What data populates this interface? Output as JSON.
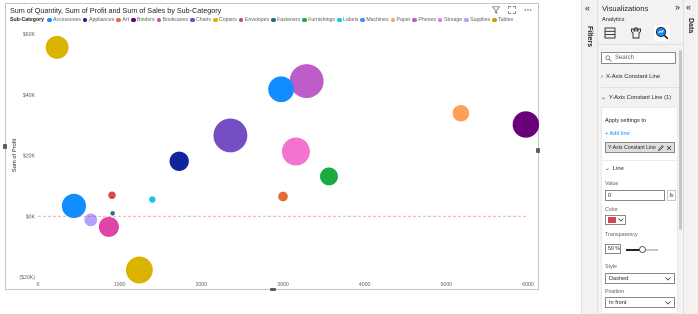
{
  "visual": {
    "title": "Sum of Quantity, Sum of Profit and Sum of Sales by Sub-Category",
    "header_icons": [
      "filter-icon",
      "focus-mode-icon",
      "more-options-icon"
    ]
  },
  "legend": {
    "title": "Sub-Category",
    "items": [
      {
        "label": "Accessories",
        "color": "#118dff"
      },
      {
        "label": "Appliances",
        "color": "#12239e"
      },
      {
        "label": "Art",
        "color": "#e66c37"
      },
      {
        "label": "Binders",
        "color": "#6b007b"
      },
      {
        "label": "Bookcases",
        "color": "#e044a7"
      },
      {
        "label": "Chairs",
        "color": "#744ec2"
      },
      {
        "label": "Copiers",
        "color": "#d9b300"
      },
      {
        "label": "Envelopes",
        "color": "#d64550"
      },
      {
        "label": "Fasteners",
        "color": "#197278"
      },
      {
        "label": "Furnishings",
        "color": "#1aab40"
      },
      {
        "label": "Labels",
        "color": "#15c6f4"
      },
      {
        "label": "Machines",
        "color": "#4092ff"
      },
      {
        "label": "Paper",
        "color": "#ffa058"
      },
      {
        "label": "Phones",
        "color": "#be5dc9"
      },
      {
        "label": "Storage",
        "color": "#f472d0"
      },
      {
        "label": "Supplies",
        "color": "#b5a1ff"
      },
      {
        "label": "Tables",
        "color": "#c4a200"
      }
    ]
  },
  "chart_data": {
    "type": "scatter",
    "title": "Sum of Quantity, Sum of Profit and Sum of Sales by Sub-Category",
    "xlabel": "Sum of Quantity",
    "ylabel": "Sum of Profit",
    "xlim": [
      0,
      6000
    ],
    "ylim": [
      -20000,
      60000
    ],
    "x_ticks": [
      "0",
      "1000",
      "2000",
      "3000",
      "4000",
      "5000",
      "6000"
    ],
    "y_ticks": [
      "($20K)",
      "$0K",
      "$20K",
      "$40K",
      "$60K"
    ],
    "reference_line": {
      "axis": "y",
      "value": 0,
      "style": "dashed",
      "color": "#d64550"
    },
    "points": [
      {
        "name": "Copiers",
        "x": 234,
        "y": 55600,
        "size": 150000,
        "color": "#d9b300"
      },
      {
        "name": "Phones",
        "x": 3289,
        "y": 44500,
        "size": 330000,
        "color": "#be5dc9"
      },
      {
        "name": "Machines",
        "x": 2977,
        "y": 41800,
        "size": 190000,
        "color": "#118dff"
      },
      {
        "name": "Paper",
        "x": 5178,
        "y": 33900,
        "size": 78000,
        "color": "#ffa058"
      },
      {
        "name": "Binders",
        "x": 5974,
        "y": 30200,
        "size": 200000,
        "color": "#6b007b"
      },
      {
        "name": "Chairs",
        "x": 2356,
        "y": 26600,
        "size": 328000,
        "color": "#744ec2"
      },
      {
        "name": "Storage",
        "x": 3158,
        "y": 21300,
        "size": 224000,
        "color": "#f472d0"
      },
      {
        "name": "Appliances",
        "x": 1729,
        "y": 18100,
        "size": 107000,
        "color": "#12239e"
      },
      {
        "name": "Furnishings",
        "x": 3563,
        "y": 13100,
        "size": 92000,
        "color": "#1aab40"
      },
      {
        "name": "Envelopes",
        "x": 906,
        "y": 6900,
        "size": 16000,
        "color": "#d64550"
      },
      {
        "name": "Art",
        "x": 3000,
        "y": 6500,
        "size": 27000,
        "color": "#e66c37"
      },
      {
        "name": "Labels",
        "x": 1400,
        "y": 5500,
        "size": 12000,
        "color": "#15c6f4"
      },
      {
        "name": "Accessories",
        "x": 2976,
        "y": 41900,
        "size": 168000,
        "color": "#118dff"
      },
      {
        "name": "Accessories",
        "x": 440,
        "y": 3400,
        "size": 168000,
        "color": "#118dff"
      },
      {
        "name": "Fasteners",
        "x": 914,
        "y": 950,
        "size": 3000,
        "color": "#197278"
      },
      {
        "name": "Supplies",
        "x": 647,
        "y": -1200,
        "size": 47000,
        "color": "#b5a1ff"
      },
      {
        "name": "Bookcases",
        "x": 868,
        "y": -3500,
        "size": 115000,
        "color": "#e044a7"
      },
      {
        "name": "Tables",
        "x": 1241,
        "y": -17700,
        "size": 207000,
        "color": "#d9b300"
      }
    ]
  },
  "filters_pane": {
    "label": "Filters"
  },
  "viz_pane": {
    "title": "Visualizations",
    "tab_label": "Analytics",
    "search_placeholder": "Search",
    "x_section": "X-Axis Constant Line",
    "y_section": "Y-Axis Constant Line (1)",
    "apply_label": "Apply settings to",
    "add_line": "+ Add line",
    "chip_label": "Y-Axis Constant Line",
    "line_header": "Line",
    "value_label": "Value",
    "value": "0",
    "fx_label": "fx",
    "color_label": "Color",
    "line_color": "#d64550",
    "transparency_label": "Transparency",
    "transparency": "50 %",
    "transparency_value": 50,
    "style_label": "Style",
    "style_value": "Dashed",
    "position_label": "Position",
    "position_value": "In front"
  },
  "data_pane": {
    "label": "Data"
  }
}
